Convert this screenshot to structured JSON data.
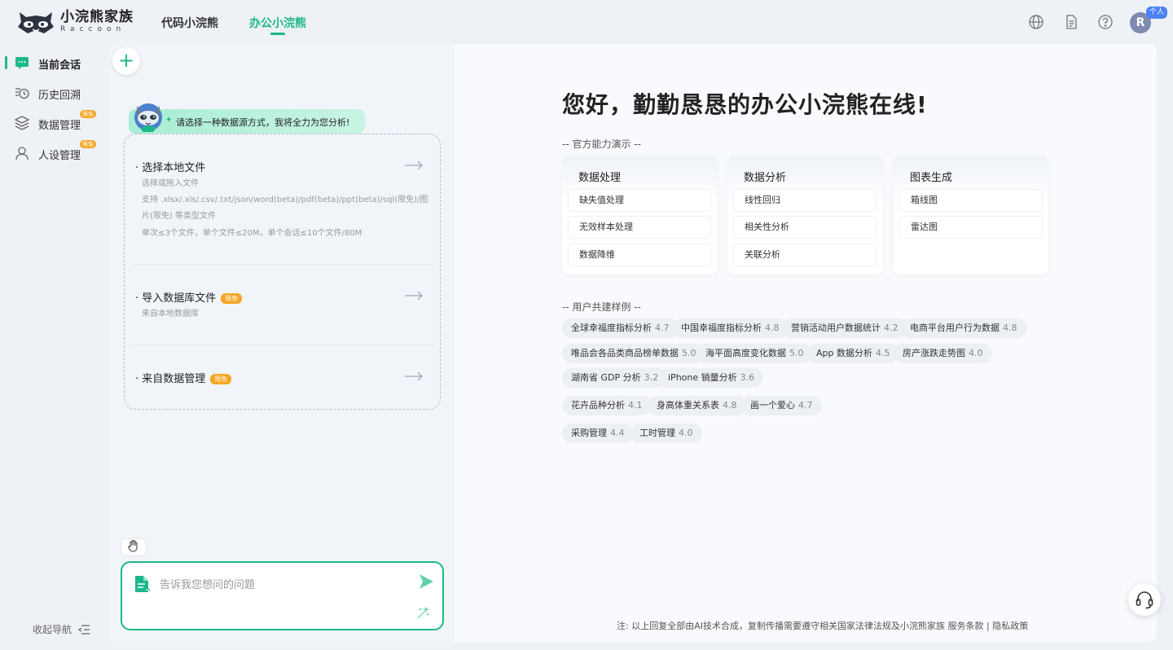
{
  "brand": {
    "name": "小浣熊家族",
    "sub": "Raccoon"
  },
  "top_tabs": [
    {
      "label": "代码小浣熊",
      "active": false
    },
    {
      "label": "办公小浣熊",
      "active": true
    }
  ],
  "header_icons": [
    "globe-icon",
    "document-icon",
    "help-icon"
  ],
  "user": {
    "avatar_letter": "R",
    "badge": "个人"
  },
  "sidebar": {
    "items": [
      {
        "label": "当前会话",
        "icon": "chat-icon",
        "active": true,
        "badge": ""
      },
      {
        "label": "历史回溯",
        "icon": "history-icon",
        "active": false,
        "badge": ""
      },
      {
        "label": "数据管理",
        "icon": "layers-icon",
        "active": false,
        "badge": "限免"
      },
      {
        "label": "人设管理",
        "icon": "person-icon",
        "active": false,
        "badge": "限免"
      }
    ],
    "collapse_label": "收起导航"
  },
  "left": {
    "bot_message": "请选择一种数据源方式，我将全力为您分析!",
    "sources": [
      {
        "title": "· 选择本地文件",
        "badge": "",
        "desc": [
          "选择或拖入文件",
          "支持 .xlsx/.xls/.csv/.txt/json/word(beta)/pdf(beta)/ppt(beta)/sql(限免)/图片(限免) 等类型文件",
          "单次≤3个文件，单个文件≤20M，单个会话≤10个文件/80M"
        ]
      },
      {
        "title": "· 导入数据库文件",
        "badge": "限免",
        "desc": [
          "来自本地数据库"
        ]
      },
      {
        "title": "· 来自数据管理",
        "badge": "限免",
        "desc": []
      }
    ],
    "input_placeholder": "告诉我您想问的问题"
  },
  "right": {
    "welcome": "您好，勤勤恳恳的办公小浣熊在线!",
    "capability_label": "-- 官方能力演示 --",
    "capabilities": [
      {
        "title": "数据处理",
        "items": [
          "缺失值处理",
          "无效样本处理",
          "数据降维"
        ]
      },
      {
        "title": "数据分析",
        "items": [
          "线性回归",
          "相关性分析",
          "关联分析"
        ]
      },
      {
        "title": "图表生成",
        "items": [
          "箱线图",
          "雷达图"
        ]
      }
    ],
    "community_label": "-- 用户共建样例 --",
    "examples": [
      {
        "name": "全球幸福度指标分析",
        "score": "4.7"
      },
      {
        "name": "中国幸福度指标分析",
        "score": "4.8"
      },
      {
        "name": "营销活动用户数据统计",
        "score": "4.2"
      },
      {
        "name": "电商平台用户行为数据",
        "score": "4.8"
      },
      {
        "name": "唯品会各品类商品榜单数据",
        "score": "5.0"
      },
      {
        "name": "海平面高度变化数据",
        "score": "5.0"
      },
      {
        "name": "App 数据分析",
        "score": "4.5"
      },
      {
        "name": "房产涨跌走势图",
        "score": "4.0"
      },
      {
        "name": "湖南省 GDP 分析",
        "score": "3.2"
      },
      {
        "name": "iPhone 销量分析",
        "score": "3.6"
      },
      {
        "name": "花卉品种分析",
        "score": "4.1"
      },
      {
        "name": "身高体重关系表",
        "score": "4.8"
      },
      {
        "name": "画一个爱心",
        "score": "4.7"
      },
      {
        "name": "采购管理",
        "score": "4.4"
      },
      {
        "name": "工时管理",
        "score": "4.0"
      }
    ],
    "footer": {
      "note": "注: 以上回复全部由AI技术合成，复制传播需要遵守相关国家法律法规及小浣熊家族",
      "terms": "服务条款",
      "sep": "|",
      "privacy": "隐私政策"
    }
  },
  "colors": {
    "accent": "#1bb889",
    "badge": "#f5a623",
    "avatar": "#7e8ab0"
  }
}
